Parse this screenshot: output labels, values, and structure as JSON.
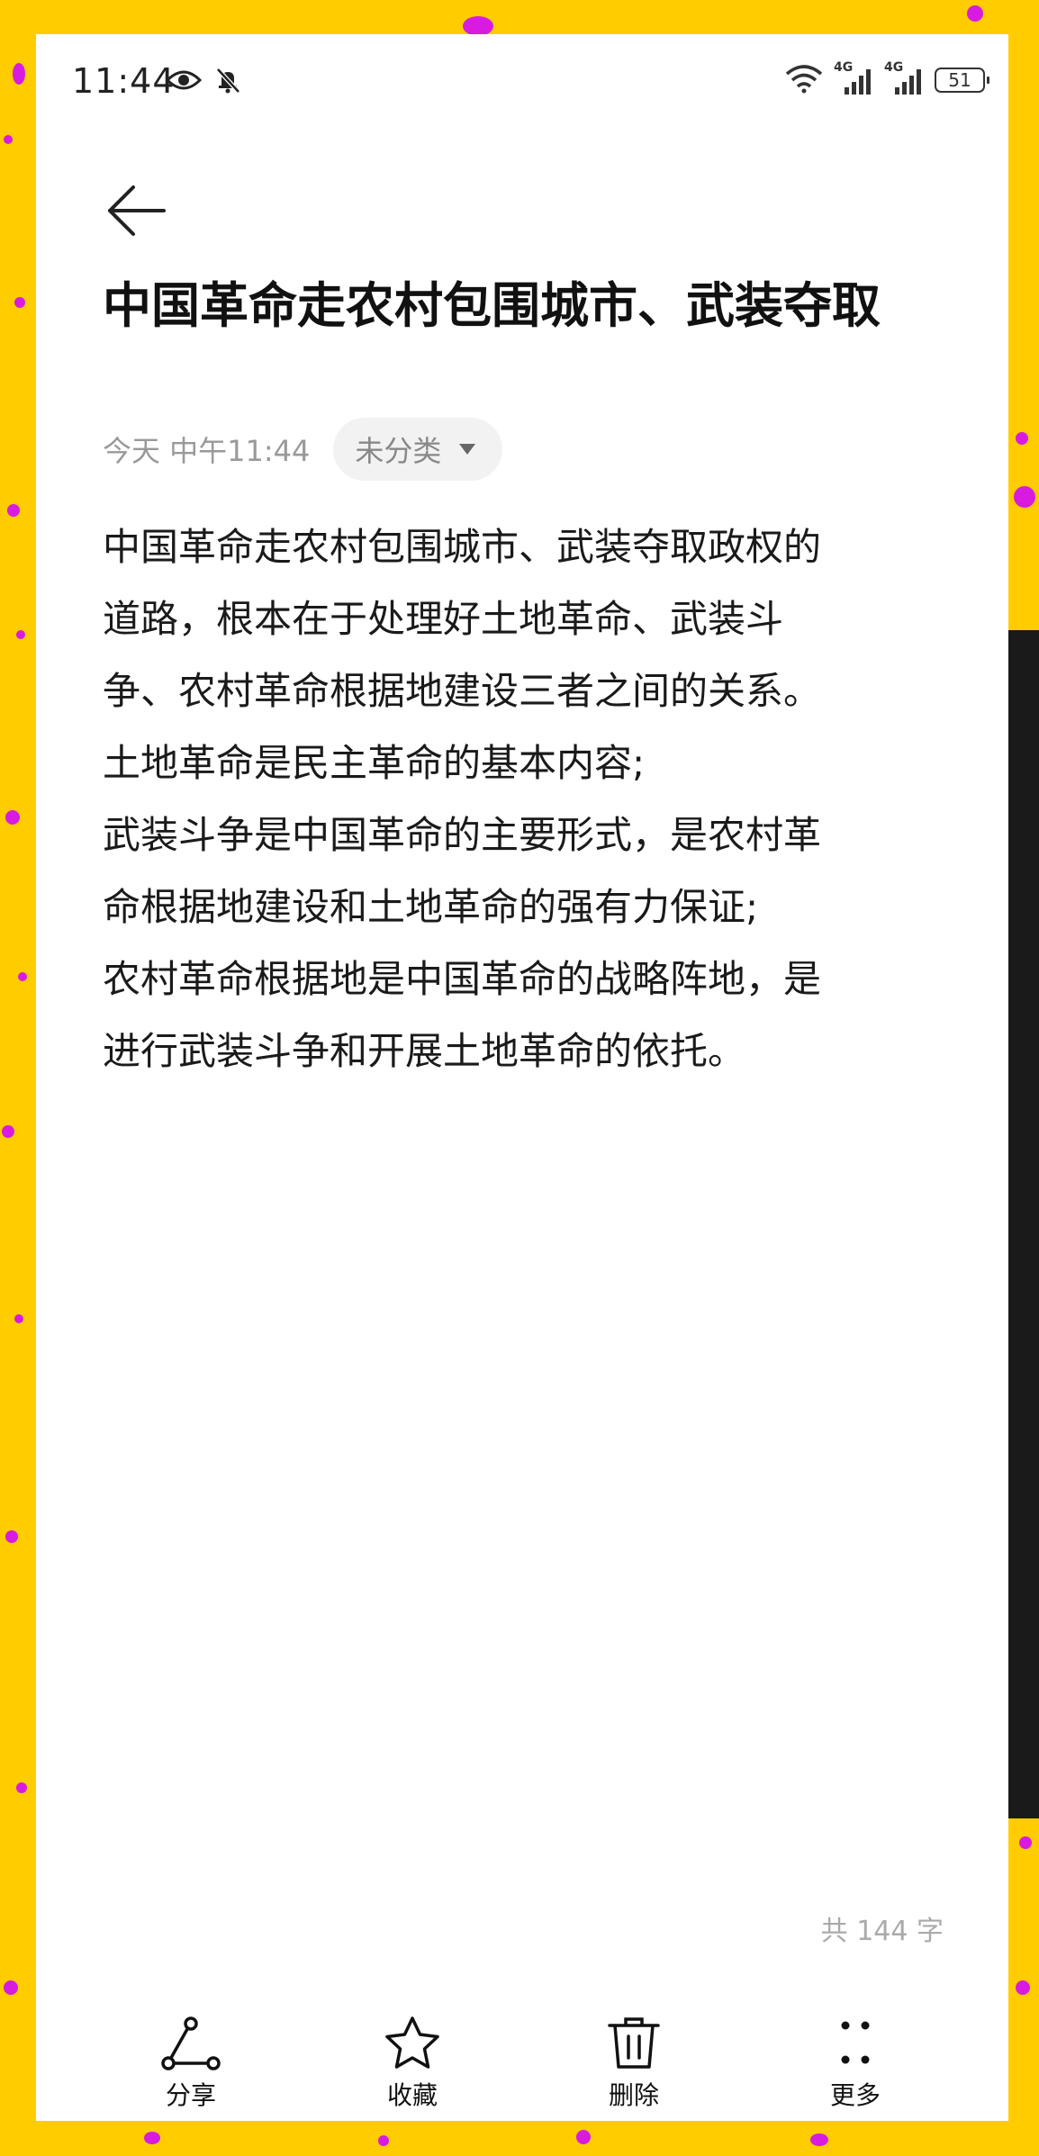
{
  "status_bar": {
    "time": "11:44",
    "network_1": "4G",
    "network_2": "4G",
    "battery": "51"
  },
  "note": {
    "title": "中国革命走农村包围城市、武装夺取",
    "date": "今天 中午11:44",
    "category": "未分类",
    "lines": [
      "中国革命走农村包围城市、武装夺取政权的",
      "道路，根本在于处理好土地革命、武装斗",
      "争、农村革命根据地建设三者之间的关系。",
      "土地革命是民主革命的基本内容;",
      "武装斗争是中国革命的主要形式，是农村革",
      "命根据地建设和土地革命的强有力保证;",
      "农村革命根据地是中国革命的战略阵地，是",
      "进行武装斗争和开展土地革命的依托。"
    ],
    "word_count": "共 144 字"
  },
  "toolbar": {
    "share_label": "分享",
    "favorite_label": "收藏",
    "delete_label": "删除",
    "more_label": "更多"
  },
  "icons": {
    "back": "arrow-left-icon",
    "eye": "eye-icon",
    "bell_off": "bell-off-icon",
    "wifi": "wifi-icon",
    "signal": "signal-icon",
    "battery": "battery-icon",
    "dropdown": "triangle-down-icon",
    "share": "share-icon",
    "favorite": "star-icon",
    "delete": "trash-icon",
    "more": "more-dots-icon"
  },
  "colors": {
    "frame_background": "#FFCC00",
    "frame_dots": "#D81BE0",
    "chip_background": "#F2F2F2",
    "secondary_text": "#999999"
  }
}
